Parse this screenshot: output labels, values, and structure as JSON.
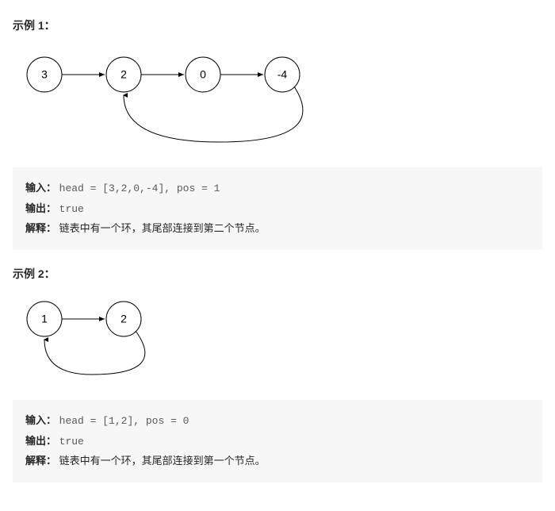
{
  "examples": [
    {
      "title": "示例 1：",
      "nodes": [
        "3",
        "2",
        "0",
        "-4"
      ],
      "cycle_back_to_index": 1,
      "input_label": "输入：",
      "input_value": "head = [3,2,0,-4], pos = 1",
      "output_label": "输出：",
      "output_value": "true",
      "explain_label": "解释：",
      "explain_value": "链表中有一个环，其尾部连接到第二个节点。"
    },
    {
      "title": "示例 2：",
      "nodes": [
        "1",
        "2"
      ],
      "cycle_back_to_index": 0,
      "input_label": "输入：",
      "input_value": "head = [1,2], pos = 0",
      "output_label": "输出：",
      "output_value": "true",
      "explain_label": "解释：",
      "explain_value": "链表中有一个环，其尾部连接到第一个节点。"
    }
  ]
}
